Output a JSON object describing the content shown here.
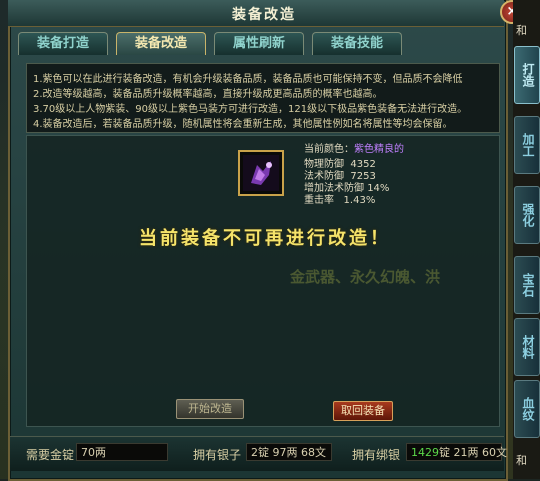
{
  "window": {
    "title": "装备改造",
    "close_symbol": "×"
  },
  "tabs": [
    {
      "label": "装备打造",
      "active": false
    },
    {
      "label": "装备改造",
      "active": true
    },
    {
      "label": "属性刷新",
      "active": false
    },
    {
      "label": "装备技能",
      "active": false
    }
  ],
  "info_lines": [
    "1.紫色可以在此进行装备改造，有机会升级装备品质，装备品质也可能保持不变，但品质不会降低",
    "2.改造等级越高，装备品质升级概率越高，直接升级成更高品质的概率也越高。",
    "3.70级以上人物紫装、90级以上紫色马装方可进行改造，121级以下极品紫色装备无法进行改造。",
    "4.装备改造后，若装备品质升级，随机属性将会重新生成，其他属性例如名将属性等均会保留。"
  ],
  "item": {
    "icon": "purple-equipment-icon",
    "quality_label": "当前颜色：",
    "quality_value": "紫色精良的",
    "stats": [
      {
        "name": "物理防御",
        "value": "4352"
      },
      {
        "name": "法术防御",
        "value": "7253"
      },
      {
        "name": "增加法术防御",
        "value": "14%"
      },
      {
        "name": "重击率",
        "value": "1.43%"
      }
    ]
  },
  "message": "当前装备不可再进行改造！",
  "background_text": "金武器、永久幻魄、洪",
  "buttons": {
    "start": "开始改造",
    "return": "取回装备"
  },
  "bottom": {
    "need_label": "需要金锭",
    "need_value": "70两",
    "silver_label": "拥有银子",
    "silver_value": "2锭 97两 68文",
    "bound_label": "拥有绑银",
    "bound_highlight": "1429",
    "bound_rest": "锭 21两 60文"
  },
  "side": {
    "top_text": "和",
    "tabs": [
      {
        "label": "打造",
        "active": true
      },
      {
        "label": "加工",
        "active": false
      },
      {
        "label": "强化",
        "active": false
      },
      {
        "label": "宝石",
        "active": false
      },
      {
        "label": "材料",
        "active": false
      },
      {
        "label": "血纹",
        "active": false
      }
    ],
    "bottom_text": "和"
  },
  "colors": {
    "accent_gold": "#f5e36a",
    "purple_quality": "#c080ff",
    "green_value": "#5cd84a"
  }
}
